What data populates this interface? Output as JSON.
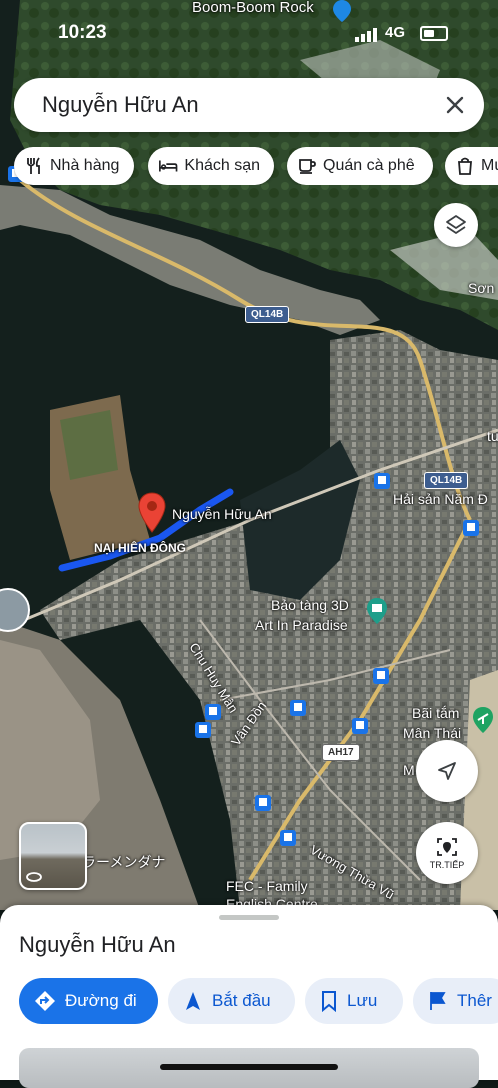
{
  "status": {
    "time": "10:23",
    "network": "4G"
  },
  "search": {
    "query": "Nguyễn Hữu An"
  },
  "chips": [
    {
      "label": "Nhà hàng",
      "icon": "fork-knife-icon"
    },
    {
      "label": "Khách sạn",
      "icon": "bed-icon"
    },
    {
      "label": "Quán cà phê",
      "icon": "coffee-icon"
    },
    {
      "label": "Mu",
      "icon": "shopping-bag-icon"
    }
  ],
  "map": {
    "labels": {
      "top_poi": "Boom-Boom Rock",
      "son": "Sơn",
      "tu": "tu",
      "street_selected": "Nguyễn Hữu An",
      "district": "NẠI HIÊN ĐÔNG",
      "hai_san": "Hải sản Năm Đ",
      "museum_line1": "Bảo tàng 3D",
      "museum_line2": "Art In Paradise",
      "chu_huy_man": "Chu Huy Mân",
      "van_don": "Vân Đồn",
      "bai_tam_line1": "Bãi tắm",
      "bai_tam_line2": "Mân Thái",
      "vuong_thua_vu": "Vương Thừa Vũ",
      "ramen": "ラーメンダナ",
      "fec_line1": "FEC - Family",
      "fec_line2": "English Centre",
      "m_letter": "M"
    },
    "shields": {
      "ql14b_a": "QL14B",
      "ql14b_b": "QL14B",
      "ah17": "AH17"
    },
    "next_label": "TR.TIẾP"
  },
  "sheet": {
    "title": "Nguyễn Hữu An",
    "buttons": {
      "directions": "Đường đi",
      "start": "Bắt đầu",
      "save": "Lưu",
      "add": "Thêr"
    }
  }
}
